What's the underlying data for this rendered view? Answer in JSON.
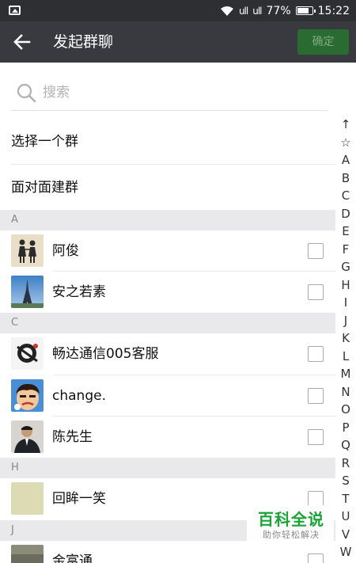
{
  "status_bar": {
    "signal1": "ull",
    "signal2": "ull",
    "battery_pct": "77%",
    "time": "15:22"
  },
  "header": {
    "title": "发起群聊",
    "confirm_label": "确定"
  },
  "search": {
    "placeholder": "搜索"
  },
  "actions": {
    "select_group": "选择一个群",
    "face_to_face": "面对面建群"
  },
  "sections": [
    {
      "letter": "A",
      "contacts": [
        "阿俊",
        "安之若素"
      ]
    },
    {
      "letter": "C",
      "contacts": [
        "畅达通信005客服",
        "change.",
        "陈先生"
      ]
    },
    {
      "letter": "H",
      "contacts": [
        "回眸一笑"
      ]
    },
    {
      "letter": "J",
      "contacts": [
        "金富通"
      ]
    }
  ],
  "index_letters": [
    "↑",
    "☆",
    "A",
    "B",
    "C",
    "D",
    "E",
    "F",
    "G",
    "H",
    "I",
    "J",
    "K",
    "L",
    "M",
    "N",
    "O",
    "P",
    "Q",
    "R",
    "S",
    "T",
    "U",
    "V",
    "W"
  ],
  "watermark": {
    "main": "百科全说",
    "sub": "助你轻松解决"
  },
  "colors": {
    "title_bar": "#393a3f",
    "status_bar": "#2e2f33",
    "confirm_button": "#2a6b31",
    "watermark_green": "#1aa336"
  },
  "icons": {
    "back": "arrow-left-icon",
    "search": "search-icon",
    "wifi": "wifi-icon",
    "battery": "battery-icon"
  }
}
